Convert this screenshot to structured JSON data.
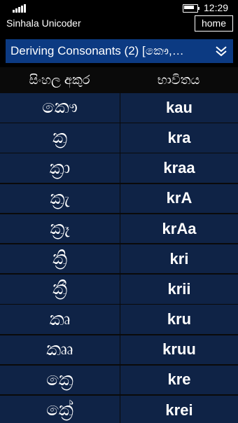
{
  "status_bar": {
    "time": "12:29",
    "signal_icon": "signal-bars-icon",
    "battery_icon": "battery-icon",
    "battery_level": 0.8
  },
  "header": {
    "app_title": "Sinhala Unicoder",
    "home_label": "home"
  },
  "topic": {
    "label": "Deriving Consonants (2) [කෞ,…",
    "expand_icon": "double-chevron-down-icon"
  },
  "table": {
    "columns": [
      "සිංහල අකුර",
      "භාවිතය"
    ],
    "rows": [
      {
        "letter": "කෞ",
        "roman": "kau"
      },
      {
        "letter": "ක්‍ර",
        "roman": "kra"
      },
      {
        "letter": "ක්‍රා",
        "roman": "kraa"
      },
      {
        "letter": "ක්‍රැ",
        "roman": "krA"
      },
      {
        "letter": "ක්‍රෑ",
        "roman": "krAa"
      },
      {
        "letter": "ක්‍රි",
        "roman": "kri"
      },
      {
        "letter": "ක්‍රී",
        "roman": "krii"
      },
      {
        "letter": "කෘ",
        "roman": "kru"
      },
      {
        "letter": "කෲ",
        "roman": "kruu"
      },
      {
        "letter": "ක්‍රෙ",
        "roman": "kre"
      },
      {
        "letter": "ක්‍රේ",
        "roman": "krei"
      }
    ]
  }
}
